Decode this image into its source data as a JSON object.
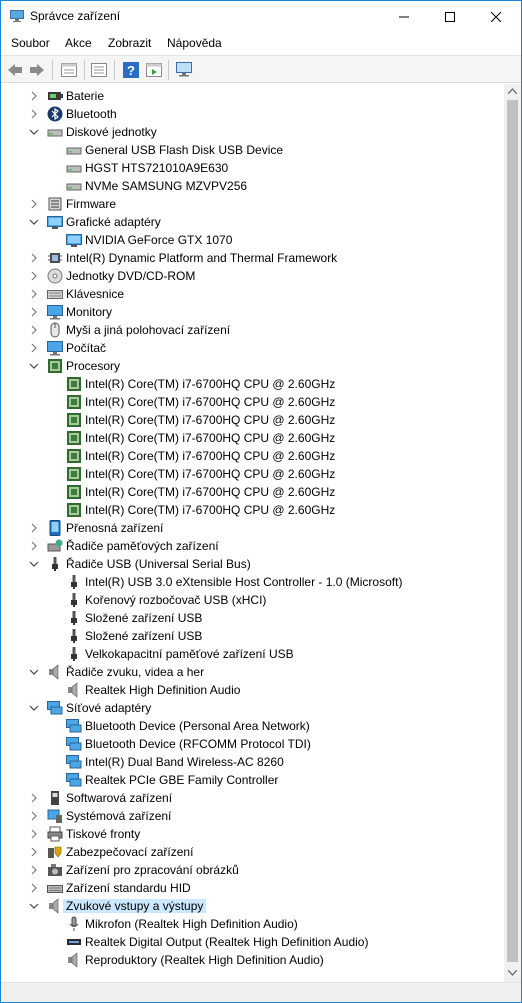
{
  "window": {
    "title": "Správce zařízení"
  },
  "menu": [
    "Soubor",
    "Akce",
    "Zobrazit",
    "Nápověda"
  ],
  "toolbar": [
    "back-icon",
    "forward-icon",
    "properties-icon",
    "list-view-icon",
    "help-icon",
    "action-icon",
    "monitor-scan-icon"
  ],
  "tree": [
    {
      "label": "Baterie",
      "level": 0,
      "state": "collapsed",
      "icon": "battery"
    },
    {
      "label": "Bluetooth",
      "level": 0,
      "state": "collapsed",
      "icon": "bluetooth"
    },
    {
      "label": "Diskové jednotky",
      "level": 0,
      "state": "expanded",
      "icon": "disk"
    },
    {
      "label": "General USB Flash Disk USB Device",
      "level": 1,
      "icon": "disk"
    },
    {
      "label": "HGST HTS721010A9E630",
      "level": 1,
      "icon": "disk"
    },
    {
      "label": "NVMe SAMSUNG MZVPV256",
      "level": 1,
      "icon": "disk"
    },
    {
      "label": "Firmware",
      "level": 0,
      "state": "collapsed",
      "icon": "firmware"
    },
    {
      "label": "Grafické adaptéry",
      "level": 0,
      "state": "expanded",
      "icon": "display"
    },
    {
      "label": "NVIDIA GeForce GTX 1070",
      "level": 1,
      "icon": "display"
    },
    {
      "label": "Intel(R) Dynamic Platform and Thermal Framework",
      "level": 0,
      "state": "collapsed",
      "icon": "chip"
    },
    {
      "label": "Jednotky DVD/CD-ROM",
      "level": 0,
      "state": "collapsed",
      "icon": "dvd"
    },
    {
      "label": "Klávesnice",
      "level": 0,
      "state": "collapsed",
      "icon": "keyboard"
    },
    {
      "label": "Monitory",
      "level": 0,
      "state": "collapsed",
      "icon": "monitor"
    },
    {
      "label": "Myši a jiná polohovací zařízení",
      "level": 0,
      "state": "collapsed",
      "icon": "mouse"
    },
    {
      "label": "Počítač",
      "level": 0,
      "state": "collapsed",
      "icon": "monitor"
    },
    {
      "label": "Procesory",
      "level": 0,
      "state": "expanded",
      "icon": "cpu"
    },
    {
      "label": "Intel(R) Core(TM) i7-6700HQ CPU @ 2.60GHz",
      "level": 1,
      "icon": "cpu"
    },
    {
      "label": "Intel(R) Core(TM) i7-6700HQ CPU @ 2.60GHz",
      "level": 1,
      "icon": "cpu"
    },
    {
      "label": "Intel(R) Core(TM) i7-6700HQ CPU @ 2.60GHz",
      "level": 1,
      "icon": "cpu"
    },
    {
      "label": "Intel(R) Core(TM) i7-6700HQ CPU @ 2.60GHz",
      "level": 1,
      "icon": "cpu"
    },
    {
      "label": "Intel(R) Core(TM) i7-6700HQ CPU @ 2.60GHz",
      "level": 1,
      "icon": "cpu"
    },
    {
      "label": "Intel(R) Core(TM) i7-6700HQ CPU @ 2.60GHz",
      "level": 1,
      "icon": "cpu"
    },
    {
      "label": "Intel(R) Core(TM) i7-6700HQ CPU @ 2.60GHz",
      "level": 1,
      "icon": "cpu"
    },
    {
      "label": "Intel(R) Core(TM) i7-6700HQ CPU @ 2.60GHz",
      "level": 1,
      "icon": "cpu"
    },
    {
      "label": "Přenosná zařízení",
      "level": 0,
      "state": "collapsed",
      "icon": "portable"
    },
    {
      "label": "Řadiče paměťových zařízení",
      "level": 0,
      "state": "collapsed",
      "icon": "storage"
    },
    {
      "label": "Řadiče USB (Universal Serial Bus)",
      "level": 0,
      "state": "expanded",
      "icon": "usb"
    },
    {
      "label": "Intel(R) USB 3.0 eXtensible Host Controller - 1.0 (Microsoft)",
      "level": 1,
      "icon": "usb"
    },
    {
      "label": "Kořenový rozbočovač USB (xHCI)",
      "level": 1,
      "icon": "usb"
    },
    {
      "label": "Složené zařízení USB",
      "level": 1,
      "icon": "usb"
    },
    {
      "label": "Složené zařízení USB",
      "level": 1,
      "icon": "usb"
    },
    {
      "label": "Velkokapacitní paměťové zařízení USB",
      "level": 1,
      "icon": "usb"
    },
    {
      "label": "Řadiče zvuku, videa a her",
      "level": 0,
      "state": "collapsed-open",
      "icon": "speaker"
    },
    {
      "label": "Realtek High Definition Audio",
      "level": 1,
      "icon": "speaker"
    },
    {
      "label": "Síťové adaptéry",
      "level": 0,
      "state": "expanded",
      "icon": "network"
    },
    {
      "label": "Bluetooth Device (Personal Area Network)",
      "level": 1,
      "icon": "network"
    },
    {
      "label": "Bluetooth Device (RFCOMM Protocol TDI)",
      "level": 1,
      "icon": "network"
    },
    {
      "label": "Intel(R) Dual Band Wireless-AC 8260",
      "level": 1,
      "icon": "network"
    },
    {
      "label": "Realtek PCIe GBE Family Controller",
      "level": 1,
      "icon": "network"
    },
    {
      "label": "Softwarová zařízení",
      "level": 0,
      "state": "collapsed",
      "icon": "software"
    },
    {
      "label": "Systémová zařízení",
      "level": 0,
      "state": "collapsed",
      "icon": "system"
    },
    {
      "label": "Tiskové fronty",
      "level": 0,
      "state": "collapsed",
      "icon": "printer"
    },
    {
      "label": "Zabezpečovací zařízení",
      "level": 0,
      "state": "collapsed",
      "icon": "security"
    },
    {
      "label": "Zařízení pro zpracování obrázků",
      "level": 0,
      "state": "collapsed",
      "icon": "camera"
    },
    {
      "label": "Zařízení standardu HID",
      "level": 0,
      "state": "collapsed",
      "icon": "hid"
    },
    {
      "label": "Zvukové vstupy a výstupy",
      "level": 0,
      "state": "expanded",
      "icon": "speaker",
      "selected": true
    },
    {
      "label": "Mikrofon (Realtek High Definition Audio)",
      "level": 1,
      "icon": "mic"
    },
    {
      "label": "Realtek Digital Output (Realtek High Definition Audio)",
      "level": 1,
      "icon": "digital-out"
    },
    {
      "label": "Reproduktory (Realtek High Definition Audio)",
      "level": 1,
      "icon": "speaker"
    }
  ]
}
